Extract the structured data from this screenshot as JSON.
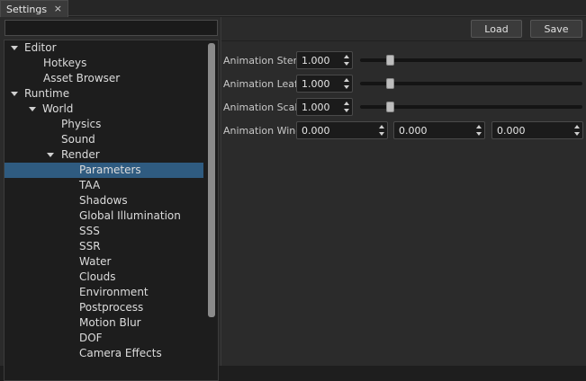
{
  "tab": {
    "label": "Settings",
    "close": "×"
  },
  "toolbar": {
    "load_label": "Load",
    "save_label": "Save"
  },
  "search": {
    "value": "",
    "placeholder": ""
  },
  "tree": {
    "editor": "Editor",
    "hotkeys": "Hotkeys",
    "asset_browser": "Asset Browser",
    "runtime": "Runtime",
    "world": "World",
    "physics": "Physics",
    "sound": "Sound",
    "render": "Render",
    "parameters": "Parameters",
    "taa": "TAA",
    "shadows": "Shadows",
    "gi": "Global Illumination",
    "sss": "SSS",
    "ssr": "SSR",
    "water": "Water",
    "clouds": "Clouds",
    "environment": "Environment",
    "postprocess": "Postprocess",
    "motion_blur": "Motion Blur",
    "dof": "DOF",
    "camera_effects": "Camera Effects"
  },
  "params": {
    "stem": {
      "label": "Animation Stem",
      "value": "1.000",
      "slider_level": 0.12
    },
    "leaf": {
      "label": "Animation Leaf",
      "value": "1.000",
      "slider_level": 0.12
    },
    "scale": {
      "label": "Animation Scale",
      "value": "1.000",
      "slider_level": 0.12
    },
    "wind": {
      "label": "Animation Wind",
      "x": "0.000",
      "y": "0.000",
      "z": "0.000"
    }
  }
}
